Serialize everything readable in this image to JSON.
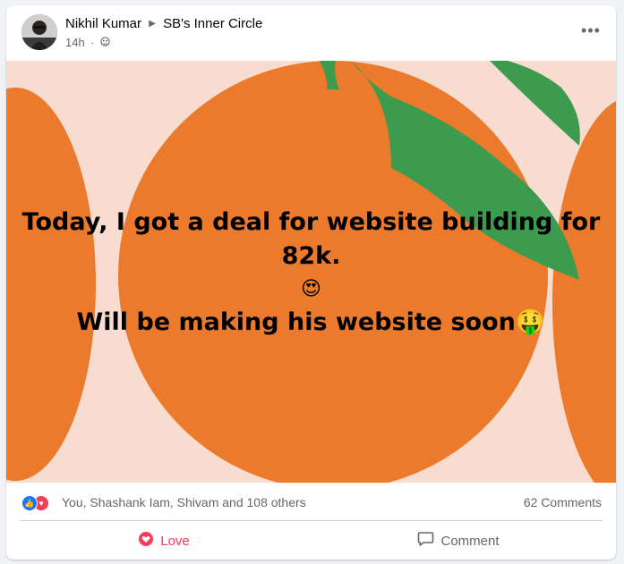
{
  "post": {
    "author": "Nikhil Kumar",
    "group": "SB's Inner Circle",
    "time": "14h",
    "separator": "·",
    "more_label": "•••",
    "text_lines": [
      "Today, I got a deal for website building for",
      "82k.",
      "😍",
      "Will be making his website soon🤑"
    ]
  },
  "reactions": {
    "summary": "You, Shashank Iam, Shivam and 108 others",
    "comments": "62 Comments"
  },
  "actions": {
    "love_label": "Love",
    "comment_label": "Comment"
  },
  "colors": {
    "background_pink": "#f7dccf",
    "orange": "#ec7a2c",
    "leaf": "#3d9b4f",
    "love": "#f33e58",
    "like": "#1877f2"
  }
}
